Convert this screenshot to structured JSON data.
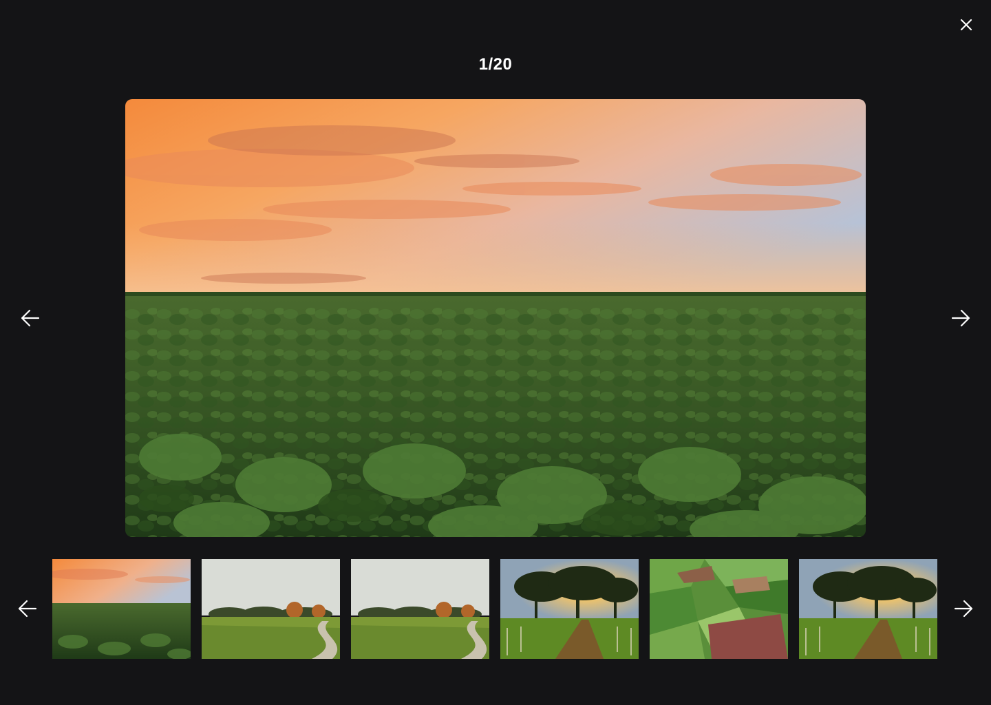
{
  "viewer": {
    "counter": "1/20",
    "current_index": 1,
    "total": 20
  },
  "icons": {
    "close": "close-icon",
    "prev": "arrow-left-icon",
    "next": "arrow-right-icon"
  },
  "colors": {
    "background": "#141416",
    "icon": "#ffffff"
  },
  "thumbnails": [
    {
      "scene": "sunset-crop-field",
      "selected": true
    },
    {
      "scene": "autumn-field-dirt-road",
      "selected": false
    },
    {
      "scene": "autumn-field-dirt-road",
      "selected": false
    },
    {
      "scene": "trees-sunset-fence",
      "selected": false
    },
    {
      "scene": "aerial-farmland-patchwork",
      "selected": false
    },
    {
      "scene": "trees-sunset-fence",
      "selected": false
    }
  ]
}
